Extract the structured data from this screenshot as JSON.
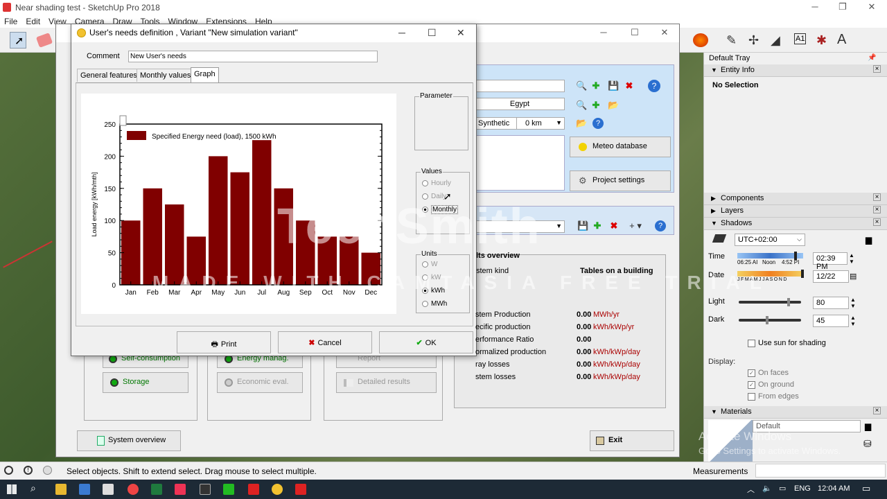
{
  "sketchup": {
    "title": "Near shading test - SketchUp Pro 2018",
    "menu": [
      "File",
      "Edit",
      "View",
      "Camera",
      "Draw",
      "Tools",
      "Window",
      "Extensions",
      "Help"
    ],
    "status_text": "Select objects. Shift to extend select. Drag mouse to select multiple.",
    "measurements_label": "Measurements"
  },
  "tray": {
    "title": "Default Tray",
    "entity_info": "Entity Info",
    "no_selection": "No Selection",
    "components": "Components",
    "layers": "Layers",
    "shadows": "Shadows",
    "timezone": "UTC+02:00",
    "time_label": "Time",
    "time_start": "06:25 AI",
    "time_noon": "Noon",
    "time_end": "4:52 PI",
    "time_value": "02:39 PM",
    "date_label": "Date",
    "months_strip": "J F M A M J J A S O N D",
    "date_value": "12/22",
    "light_label": "Light",
    "light_value": "80",
    "light_level": 80,
    "dark_label": "Dark",
    "dark_value": "45",
    "dark_level": 45,
    "use_sun": "Use sun for shading",
    "display_label": "Display:",
    "on_faces": "On faces",
    "on_ground": "On ground",
    "from_edges": "From edges",
    "materials": "Materials",
    "material_default": "Default"
  },
  "pvsyst": {
    "country": "Egypt",
    "synthetic": "Synthetic",
    "distance": "0 km",
    "meteo_button": "Meteo database",
    "project_button": "Project settings",
    "results_title": "lts overview",
    "system_kind_label": "stem kind",
    "system_kind_value": "Tables on a building",
    "results": [
      {
        "label": "stem Production",
        "value": "0.00",
        "unit": "MWh/yr"
      },
      {
        "label": "ecific production",
        "value": "0.00",
        "unit": "kWh/kWp/yr"
      },
      {
        "label": "erformance Ratio",
        "value": "0.00",
        "unit": ""
      },
      {
        "label": "ormalized production",
        "value": "0.00",
        "unit": "kWh/kWp/day"
      },
      {
        "label": "ray losses",
        "value": "0.00",
        "unit": "kWh/kWp/day"
      },
      {
        "label": "stem losses",
        "value": "0.00",
        "unit": "kWh/kWp/day"
      }
    ],
    "self_consumption": "Self-consumption",
    "energy_manag": "Energy manag.",
    "report": "Report",
    "storage": "Storage",
    "economic_eval": "Economic eval.",
    "detailed_results": "Detailed results",
    "system_overview": "System overview",
    "exit": "Exit"
  },
  "dialog": {
    "title": "User's needs definition , Variant  \"New simulation variant\"",
    "comment_label": "Comment",
    "comment_value": "New User's needs",
    "tabs": [
      "General features",
      "Monthly values",
      "Graph"
    ],
    "parameter_label": "Parameter",
    "values_label": "Values",
    "values_options": [
      "Hourly",
      "Daily",
      "Monthly"
    ],
    "units_label": "Units",
    "units_options": [
      "W",
      "kW",
      "kWh",
      "MWh"
    ],
    "print": "Print",
    "cancel": "Cancel",
    "ok": "OK"
  },
  "chart_data": {
    "type": "bar",
    "categories": [
      "Jan",
      "Feb",
      "Mar",
      "Apr",
      "May",
      "Jun",
      "Jul",
      "Aug",
      "Sep",
      "Oct",
      "Nov",
      "Dec"
    ],
    "series": [
      {
        "name": "Specified Energy need (load),  1500 kWh",
        "values": [
          100,
          150,
          125,
          75,
          200,
          175,
          225,
          150,
          100,
          75,
          75,
          50
        ],
        "color": "#800000"
      }
    ],
    "ylabel": "Load energy  [kWh/mth]",
    "ylim": [
      0,
      250
    ],
    "yticks": [
      0,
      50,
      100,
      150,
      200,
      250
    ],
    "legend": "top-left"
  },
  "watermark": {
    "brand": "TechSmith",
    "line": "MADE WITH CAMTASIA FREE TRIAL",
    "activate": "Activate Windows",
    "activate_sub": "Go to Settings to activate Windows."
  },
  "taskbar": {
    "lang": "ENG",
    "clock": "12:04 AM"
  }
}
